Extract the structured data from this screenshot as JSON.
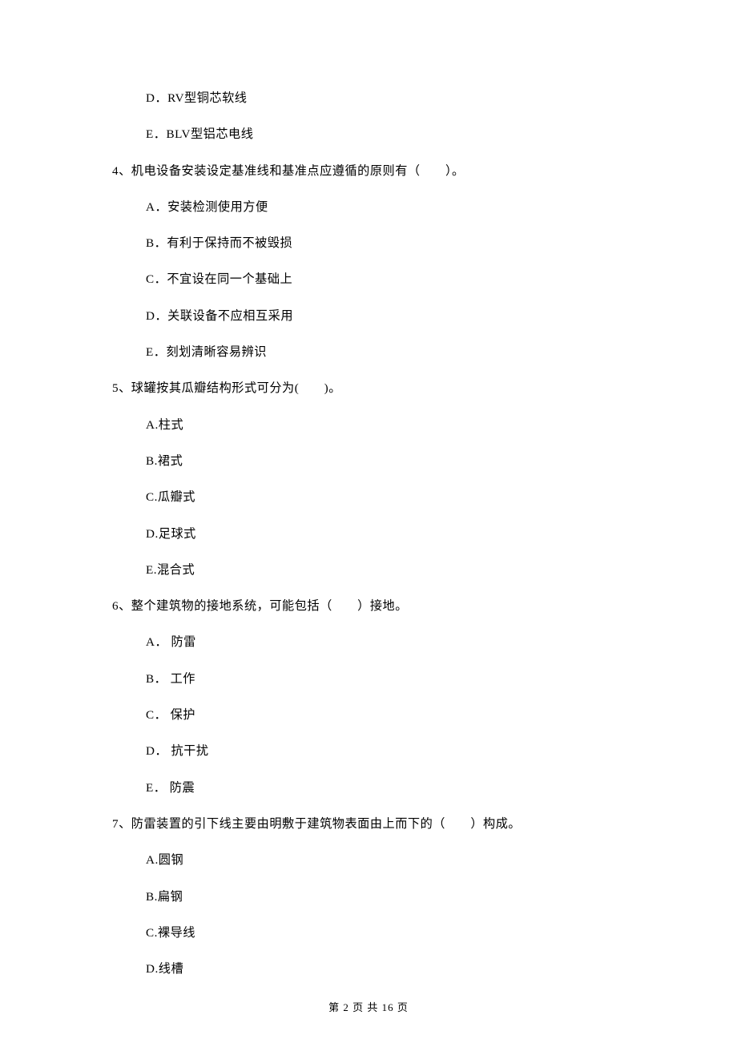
{
  "prev_options": {
    "d": "D．RV型铜芯软线",
    "e": "E．BLV型铝芯电线"
  },
  "q4": {
    "text": "4、机电设备安装设定基准线和基准点应遵循的原则有（　　）。",
    "a": "A．安装检测使用方便",
    "b": "B．有利于保持而不被毁损",
    "c": "C．不宜设在同一个基础上",
    "d": "D．关联设备不应相互采用",
    "e": "E．刻划清晰容易辨识"
  },
  "q5": {
    "text": "5、球罐按其瓜瓣结构形式可分为(　　)。",
    "a": "A.柱式",
    "b": "B.裙式",
    "c": "C.瓜瓣式",
    "d": "D.足球式",
    "e": "E.混合式"
  },
  "q6": {
    "text": "6、整个建筑物的接地系统，可能包括（　　）接地。",
    "a": "A． 防雷",
    "b": "B． 工作",
    "c": "C． 保护",
    "d": "D． 抗干扰",
    "e": "E． 防震"
  },
  "q7": {
    "text": "7、防雷装置的引下线主要由明敷于建筑物表面由上而下的（　　）构成。",
    "a": "A.圆钢",
    "b": "B.扁钢",
    "c": "C.裸导线",
    "d": "D.线槽"
  },
  "footer": "第 2 页 共 16 页"
}
